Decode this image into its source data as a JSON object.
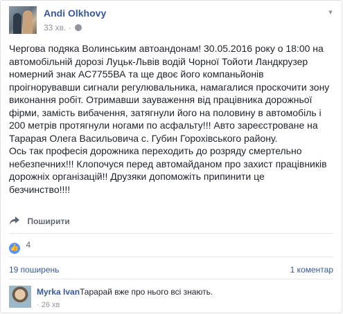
{
  "post": {
    "author": "Andi Olkhovy",
    "time": "33 хв.",
    "globe_icon": "globe-icon",
    "menu_icon": "chevron-down-icon",
    "text": "Чергова подяка Волинським автоандонам! 30.05.2016 року о 18:00 на\nавтомобільній дорозі Луцьк-Львів водій Чорної Тойоти Ландкрузер\nномерний знак АС7755ВА та ще двоє його компаньйонів\nпроігнорувавши сигнали регулювальника, намагалися проскочити зону\nвиконання робіт. Отримавши зауваження від працівника дорожньої\nфірми, замість вибачення, затягнули його на половину в автомобіль і\n200 метрів протягнули ногами по асфальту!!! Авто зареєстроване на\nТарарая Олега Васильовича с. Губин Горохівського району.\nОсь так професія дорожника переходить до розряду смертельно\nнебезпечних!!! Клопочуся перед автомайданом про захист працівників\nдорожніх організацій!! Друзяки допоможіть припинити це\nбезчинство!!!!"
  },
  "actions": {
    "share_label": "Поширити"
  },
  "reactions": {
    "count": "4"
  },
  "stats": {
    "shares": "19 поширень",
    "comments": "1 коментар"
  },
  "comment": {
    "name": "Myrka Ivan",
    "text": "Тарарай вже про нього всі знають.",
    "time": "· 26 хв"
  },
  "colors": {
    "link": "#365899",
    "muted": "#90949c",
    "like": "#5890ff"
  }
}
